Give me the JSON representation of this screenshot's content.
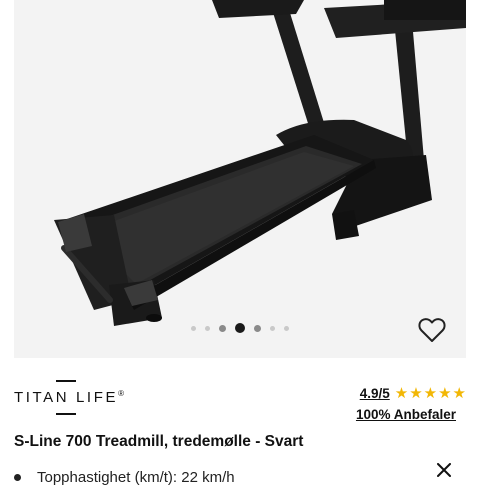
{
  "product": {
    "brand": "TITAN LIFE",
    "brand_mark": "®",
    "rating": "4.9/5",
    "stars": 5,
    "recommend": "100% Anbefaler",
    "title": "S-Line 700 Treadmill, tredemølle - Svart",
    "spec": "Topphastighet (km/t): 22 km/h"
  },
  "gallery": {
    "image_count": 7,
    "active_index": 3
  },
  "colors": {
    "star": "#f2b705",
    "hero_background": "#f3f3f3"
  },
  "icons": {
    "favorite": "heart-outline-icon",
    "close": "close-icon"
  }
}
